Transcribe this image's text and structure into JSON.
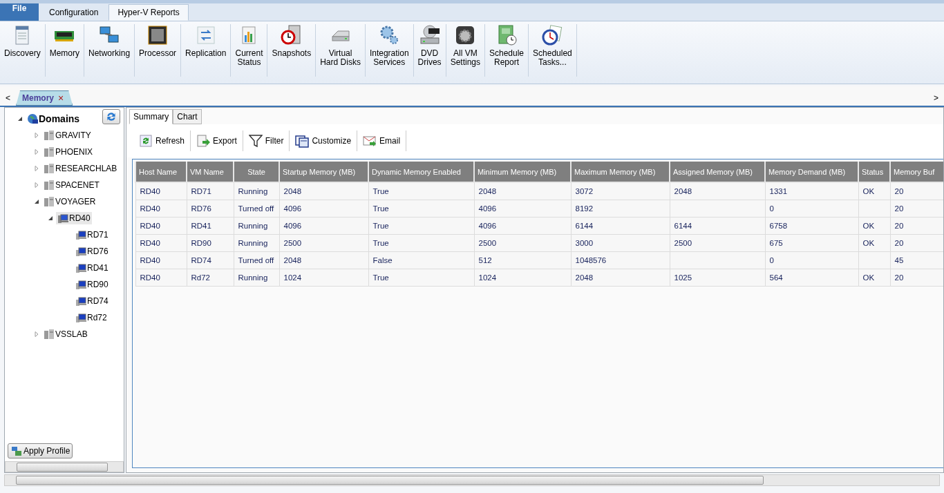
{
  "menu_tabs": [
    {
      "label": "File",
      "kind": "app",
      "selected": false
    },
    {
      "label": "Configuration",
      "kind": "tab",
      "selected": false
    },
    {
      "label": "Hyper-V Reports",
      "kind": "tab",
      "selected": true
    }
  ],
  "ribbon": [
    {
      "lines": [
        "Discovery"
      ]
    },
    {
      "lines": [
        "Memory"
      ]
    },
    {
      "lines": [
        "Networking"
      ]
    },
    {
      "lines": [
        "Processor"
      ]
    },
    {
      "lines": [
        "Replication"
      ]
    },
    {
      "lines": [
        "Current",
        "Status"
      ]
    },
    {
      "lines": [
        "Snapshots"
      ]
    },
    {
      "lines": [
        "Virtual",
        "Hard Disks"
      ]
    },
    {
      "lines": [
        "Integration",
        "Services"
      ]
    },
    {
      "lines": [
        "DVD",
        "Drives"
      ]
    },
    {
      "lines": [
        "All VM",
        "Settings"
      ]
    },
    {
      "lines": [
        "Schedule",
        "Report"
      ]
    },
    {
      "lines": [
        "Scheduled",
        "Tasks..."
      ]
    }
  ],
  "doc_tabs": {
    "prev": "<",
    "next": ">",
    "tabs": [
      {
        "label": "Memory",
        "close": "×",
        "selected": true
      }
    ]
  },
  "tree": {
    "label": "Domains",
    "kind": "root",
    "expanded": true,
    "selected": false,
    "children": [
      {
        "label": "GRAVITY",
        "kind": "domain",
        "expanded": false,
        "selected": false
      },
      {
        "label": "PHOENIX",
        "kind": "domain",
        "expanded": false,
        "selected": false
      },
      {
        "label": "RESEARCHLAB",
        "kind": "domain",
        "expanded": false,
        "selected": false
      },
      {
        "label": "SPACENET",
        "kind": "domain",
        "expanded": false,
        "selected": false
      },
      {
        "label": "VOYAGER",
        "kind": "domain",
        "expanded": true,
        "selected": false,
        "children": [
          {
            "label": "RD40",
            "kind": "host",
            "expanded": true,
            "selected": true,
            "children": [
              {
                "label": "RD71",
                "kind": "vm",
                "selected": false
              },
              {
                "label": "RD76",
                "kind": "vm",
                "selected": false
              },
              {
                "label": "RD41",
                "kind": "vm",
                "selected": false
              },
              {
                "label": "RD90",
                "kind": "vm",
                "selected": false
              },
              {
                "label": "RD74",
                "kind": "vm",
                "selected": false
              },
              {
                "label": "Rd72",
                "kind": "vm",
                "selected": false
              }
            ]
          }
        ]
      },
      {
        "label": "VSSLAB",
        "kind": "domain",
        "expanded": false,
        "selected": false
      }
    ]
  },
  "apply_profile": "Apply Profile",
  "view_tabs": [
    {
      "label": "Summary",
      "selected": true
    },
    {
      "label": "Chart",
      "selected": false
    }
  ],
  "toolbar": [
    "Refresh",
    "Export",
    "Filter",
    "Customize",
    "Email"
  ],
  "table": {
    "columns": [
      "Host Name",
      "VM Name",
      "State",
      "Startup Memory (MB)",
      "Dynamic Memory Enabled",
      "Minimum Memory (MB)",
      "Maximum Memory (MB)",
      "Assigned Memory (MB)",
      "Memory Demand (MB)",
      "Status",
      "Memory Buf"
    ],
    "rows": [
      {
        "host": "RD40",
        "vm": "RD71",
        "state": "Running",
        "startup": "2048",
        "dynamic": "True",
        "min": "2048",
        "max": "3072",
        "assigned": "2048",
        "demand": "1331",
        "status": "OK",
        "buffer": "20"
      },
      {
        "host": "RD40",
        "vm": "RD76",
        "state": "Turned off",
        "startup": "4096",
        "dynamic": "True",
        "min": "4096",
        "max": "8192",
        "demand": "0",
        "buffer": "20"
      },
      {
        "host": "RD40",
        "vm": "RD41",
        "state": "Running",
        "startup": "4096",
        "dynamic": "True",
        "min": "4096",
        "max": "6144",
        "assigned": "6144",
        "demand": "6758",
        "status": "OK",
        "buffer": "20"
      },
      {
        "host": "RD40",
        "vm": "RD90",
        "state": "Running",
        "startup": "2500",
        "dynamic": "True",
        "min": "2500",
        "max": "3000",
        "assigned": "2500",
        "demand": "675",
        "status": "OK",
        "buffer": "20"
      },
      {
        "host": "RD40",
        "vm": "RD74",
        "state": "Turned off",
        "startup": "2048",
        "dynamic": "False",
        "min": "512",
        "max": "1048576",
        "demand": "0",
        "buffer": "45"
      },
      {
        "host": "RD40",
        "vm": "Rd72",
        "state": "Running",
        "startup": "1024",
        "dynamic": "True",
        "min": "1024",
        "max": "2048",
        "assigned": "1025",
        "demand": "564",
        "status": "OK",
        "buffer": "20"
      }
    ]
  }
}
